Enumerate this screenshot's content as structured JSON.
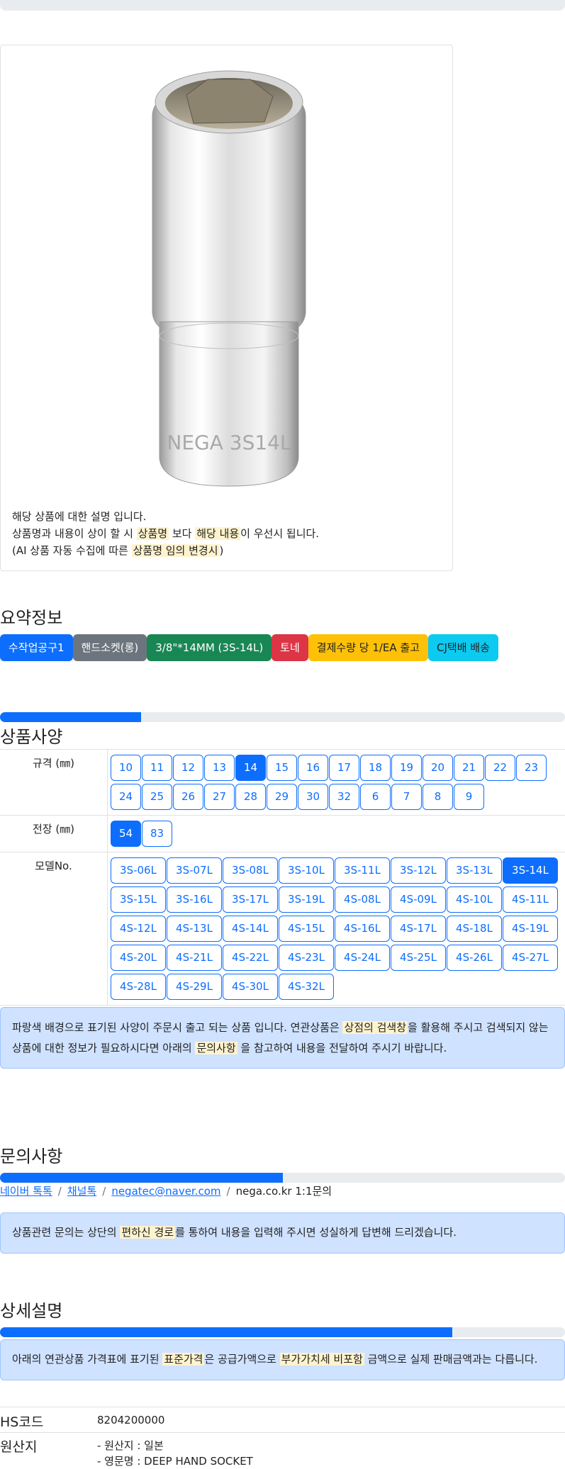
{
  "product": {
    "description_line1": "해당 상품에 대한 설명 입니다.",
    "description_line2": {
      "a": "상품명과 내용이 상이 할 시 ",
      "h1": "상품명",
      "b": " 보다 ",
      "h2": "해당 내용",
      "c": "이 우선시 됩니다."
    },
    "description_line3": {
      "a": "(AI 상품 자동 수집에 따른 ",
      "h1": "상품명 임의 변경시",
      "b": ")"
    },
    "engraving": "NEGA 3S14L"
  },
  "summary": {
    "title": "요약정보",
    "badges": [
      {
        "label": "수작업공구1",
        "color": "#0d6efd"
      },
      {
        "label": "핸드소켓(롱)",
        "color": "#6c757d"
      },
      {
        "label": "3/8\"*14MM (3S-14L)",
        "color": "#198754"
      },
      {
        "label": "토네",
        "color": "#dc3545"
      },
      {
        "label": "결제수량 당 1/EA 출고",
        "color": "#ffc107",
        "text": "#222"
      },
      {
        "label": "CJ택배 배송",
        "color": "#0dcaf0",
        "text": "#222"
      }
    ]
  },
  "spec": {
    "title": "상품사양",
    "progress": 0.25,
    "size_label": "규격 (㎜)",
    "sizes": [
      "10",
      "11",
      "12",
      "13",
      "14",
      "15",
      "16",
      "17",
      "18",
      "19",
      "20",
      "21",
      "22",
      "23",
      "24",
      "25",
      "26",
      "27",
      "28",
      "29",
      "30",
      "32",
      "6",
      "7",
      "8",
      "9"
    ],
    "size_selected": "14",
    "length_label": "전장 (㎜)",
    "lengths": [
      "54",
      "83"
    ],
    "length_selected": "54",
    "model_label": "모델No.",
    "models": [
      "3S-06L",
      "3S-07L",
      "3S-08L",
      "3S-10L",
      "3S-11L",
      "3S-12L",
      "3S-13L",
      "3S-14L",
      "3S-15L",
      "3S-16L",
      "3S-17L",
      "3S-19L",
      "4S-08L",
      "4S-09L",
      "4S-10L",
      "4S-11L",
      "4S-12L",
      "4S-13L",
      "4S-14L",
      "4S-15L",
      "4S-16L",
      "4S-17L",
      "4S-18L",
      "4S-19L",
      "4S-20L",
      "4S-21L",
      "4S-22L",
      "4S-23L",
      "4S-24L",
      "4S-25L",
      "4S-26L",
      "4S-27L",
      "4S-28L",
      "4S-29L",
      "4S-30L",
      "4S-32L"
    ],
    "model_selected": "3S-14L",
    "notice": {
      "a": "파랑색 배경으로 표기된 사양이 주문시 출고 되는 상품 입니다. 연관상품은 ",
      "h1": "상점의 검색창",
      "b": "을 활용해 주시고 검색되지 않는",
      "c": "상품에 대한 정보가 필요하시다면 아래의 ",
      "h2": "문의사항",
      "d": " 을 참고하여 내용을 전달하여 주시기 바랍니다."
    }
  },
  "inquiry": {
    "title": "문의사항",
    "progress": 0.5,
    "links": [
      "네이버 톡톡",
      "채널톡",
      "negatec@naver.com"
    ],
    "plain": "nega.co.kr 1:1문의",
    "notice": {
      "a": "상품관련 문의는 상단의 ",
      "h1": "편하신 경로",
      "b": "를 통하여 내용을 입력해 주시면 성실하게 답변해 드리겠습니다."
    }
  },
  "detail": {
    "title": "상세설명",
    "progress": 0.8,
    "notice": {
      "a": "아래의 연관상품 가격표에 표기된 ",
      "h1": "표준가격",
      "b": "은 공급가액으로 ",
      "h2": "부가가치세 비포함",
      "c": " 금액으로 실제 판매금액과는 다릅니다."
    }
  },
  "footer": {
    "hs_label": "HS코드",
    "hs_value": "8204200000",
    "origin_label": "원산지",
    "origin_line1": "- 원산지 : 일본",
    "origin_line2": "- 영문명 : DEEP HAND SOCKET"
  }
}
